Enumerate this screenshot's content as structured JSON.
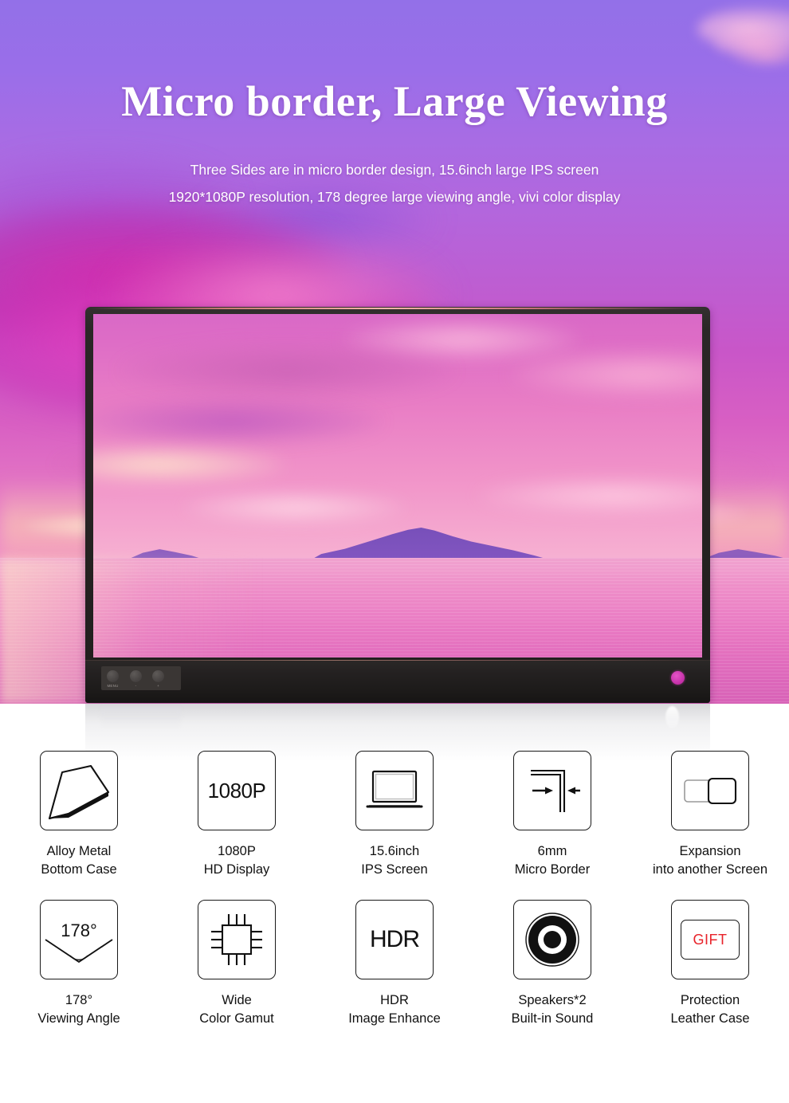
{
  "hero": {
    "title": "Micro border, Large Viewing",
    "subtitle_line1": "Three Sides are in micro border design, 15.6inch large IPS screen",
    "subtitle_line2": "1920*1080P resolution, 178 degree large viewing angle, vivi color display",
    "title_color": "#ffffff",
    "background_description": "purple-magenta sunset sky over pink ocean with island silhouette"
  },
  "monitor": {
    "buttons": [
      {
        "name": "menu-button",
        "label": "MENU"
      },
      {
        "name": "minus-button",
        "label": "-"
      },
      {
        "name": "plus-button",
        "label": "+"
      }
    ],
    "brand_indicator_color": "#d93fb8"
  },
  "features": [
    {
      "icon": "metal-plate-icon",
      "icon_text": "",
      "label_line1": "Alloy Metal",
      "label_line2": "Bottom Case"
    },
    {
      "icon": "resolution-1080p-icon",
      "icon_text": "1080P",
      "label_line1": "1080P",
      "label_line2": "HD Display"
    },
    {
      "icon": "laptop-screen-icon",
      "icon_text": "",
      "label_line1": "15.6inch",
      "label_line2": "IPS Screen"
    },
    {
      "icon": "micro-border-arrows-icon",
      "icon_text": "",
      "label_line1": "6mm",
      "label_line2": "Micro Border"
    },
    {
      "icon": "dual-screen-expansion-icon",
      "icon_text": "",
      "label_line1": "Expansion",
      "label_line2": "into another Screen"
    },
    {
      "icon": "viewing-angle-icon",
      "icon_text": "178°",
      "label_line1": "178°",
      "label_line2": "Viewing Angle"
    },
    {
      "icon": "cpu-chip-icon",
      "icon_text": "",
      "label_line1": "Wide",
      "label_line2": "Color Gamut"
    },
    {
      "icon": "hdr-icon",
      "icon_text": "HDR",
      "label_line1": "HDR",
      "label_line2": "Image Enhance"
    },
    {
      "icon": "speaker-icon",
      "icon_text": "",
      "label_line1": "Speakers*2",
      "label_line2": "Built-in Sound"
    },
    {
      "icon": "gift-case-icon",
      "icon_text": "GIFT",
      "icon_text_color": "#e8232a",
      "label_line1": "Protection",
      "label_line2": "Leather Case"
    }
  ]
}
